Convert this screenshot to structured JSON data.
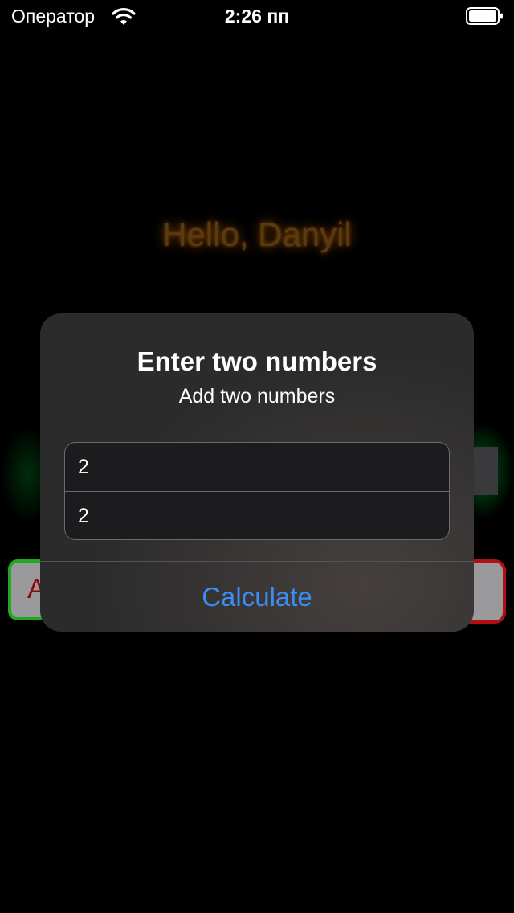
{
  "status_bar": {
    "carrier": "Оператор",
    "time": "2:26 пп",
    "wifi_icon": "wifi-icon",
    "battery_icon": "battery-icon"
  },
  "background": {
    "greeting": "Hello, Danyil",
    "left_button_partial_text": "A"
  },
  "alert": {
    "title": "Enter two numbers",
    "message": "Add two numbers",
    "fields": [
      {
        "value": "2",
        "placeholder": ""
      },
      {
        "value": "2",
        "placeholder": ""
      }
    ],
    "action_label": "Calculate"
  },
  "colors": {
    "background": "#000000",
    "alert_background": "#2b2b2b",
    "action_blue": "#3a8df2",
    "greeting_glow": "#ff8c00",
    "green_border": "#1faa1f",
    "red_border": "#b01010"
  }
}
